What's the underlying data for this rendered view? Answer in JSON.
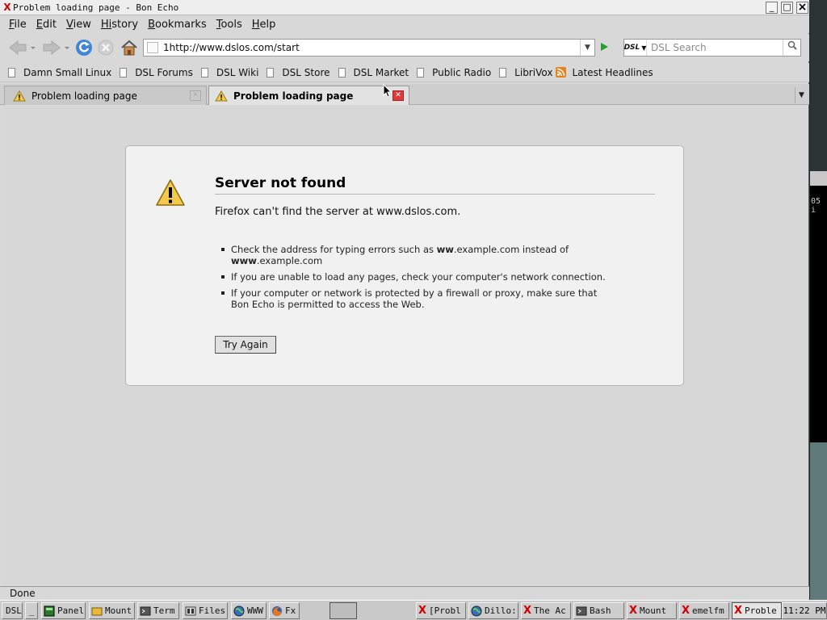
{
  "window": {
    "title": "Problem loading page - Bon Echo",
    "min": "_",
    "max": "□",
    "close": "×"
  },
  "menu": [
    {
      "u": "F",
      "rest": "ile"
    },
    {
      "u": "E",
      "rest": "dit"
    },
    {
      "u": "V",
      "rest": "iew"
    },
    {
      "u": "Hi",
      "rest": "story"
    },
    {
      "u": "B",
      "rest": "ookmarks"
    },
    {
      "u": "T",
      "rest": "ools"
    },
    {
      "u": "H",
      "rest": "elp"
    }
  ],
  "nav": {
    "url": "1http://www.dslos.com/start",
    "search_engine": "DSL",
    "search_placeholder": "DSL Search"
  },
  "bookmarks": [
    "Damn Small Linux",
    "DSL Forums",
    "DSL Wiki",
    "DSL Store",
    "DSL Market",
    "Public Radio",
    "LibriVox",
    "Latest Headlines"
  ],
  "tabs": [
    {
      "label": "Problem loading page",
      "active": false
    },
    {
      "label": "Problem loading page",
      "active": true
    }
  ],
  "error": {
    "title": "Server not found",
    "description": "Firefox can't find the server at www.dslos.com.",
    "item1_pre": "Check the address for typing errors such as ",
    "item1_b1": "ww",
    "item1_mid": ".example.com instead of ",
    "item1_b2": "www",
    "item1_post": ".example.com",
    "item2": "If you are unable to load any pages, check your computer's network connection.",
    "item3": "If your computer or network is protected by a firewall or proxy, make sure that Bon Echo is permitted to access the Web.",
    "button": "Try Again"
  },
  "status": "Done",
  "side_terminal_text": "05 i",
  "taskbar": {
    "start": "DSL",
    "dash": "_",
    "launchers": [
      "Panel",
      "Mount",
      "Term",
      "Files",
      "WWW",
      "Fx"
    ],
    "tasks": [
      "[Probl",
      "Dillo:",
      "The Ac",
      "Bash",
      "Mount",
      "emelfm",
      "Proble"
    ],
    "clock": "11:22 PM"
  },
  "colors": {
    "accent_warning": "#f2c94c",
    "close_tab": "#dd3b3b",
    "go_arrow": "#2a9b2a",
    "rss": "#e8831a",
    "x_logo": "#d00000"
  }
}
